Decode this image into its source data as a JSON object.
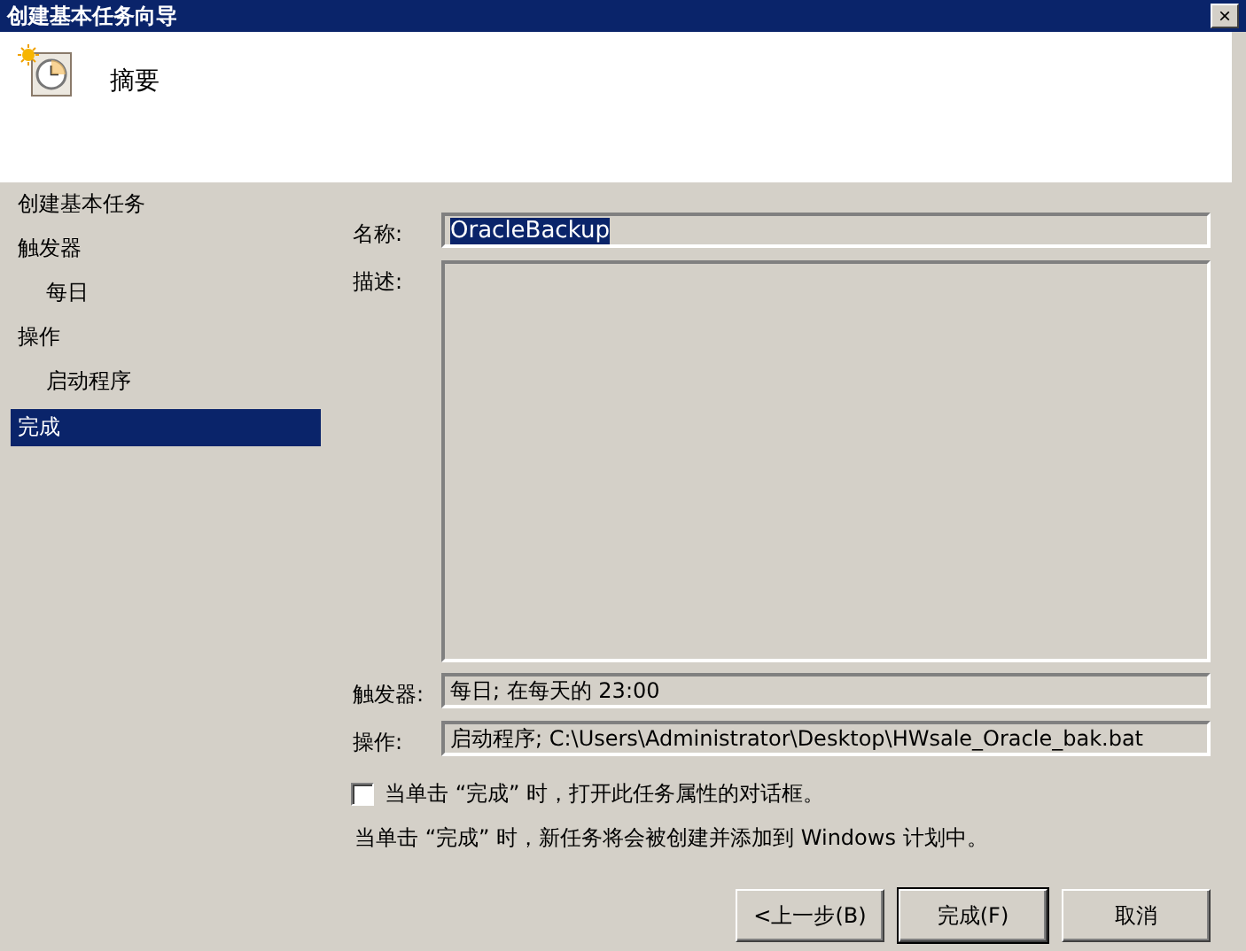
{
  "window": {
    "title": "创建基本任务向导",
    "close": "×"
  },
  "header": {
    "title": "摘要"
  },
  "sidebar": {
    "items": [
      {
        "label": "创建基本任务",
        "selected": false
      },
      {
        "label": "触发器",
        "selected": false,
        "children": [
          {
            "label": "每日",
            "selected": false
          }
        ]
      },
      {
        "label": "操作",
        "selected": false,
        "children": [
          {
            "label": "启动程序",
            "selected": false
          }
        ]
      },
      {
        "label": "完成",
        "selected": true
      }
    ]
  },
  "form": {
    "name_label": "名称:",
    "name_value": "OracleBackup",
    "description_label": "描述:",
    "trigger_label": "触发器:",
    "trigger_value": "每日; 在每天的 23:00",
    "action_label": "操作:",
    "action_value": "启动程序; C:\\Users\\Administrator\\Desktop\\HWsale_Oracle_bak.bat",
    "open_properties": {
      "label": "当单击 “完成” 时，打开此任务属性的对话框。",
      "checked": false
    },
    "note": "当单击 “完成” 时，新任务将会被创建并添加到 Windows 计划中。"
  },
  "buttons": [
    {
      "label": "<上一步(B)",
      "default": false
    },
    {
      "label": "完成(F)",
      "default": true
    },
    {
      "label": "取消",
      "default": false
    }
  ]
}
